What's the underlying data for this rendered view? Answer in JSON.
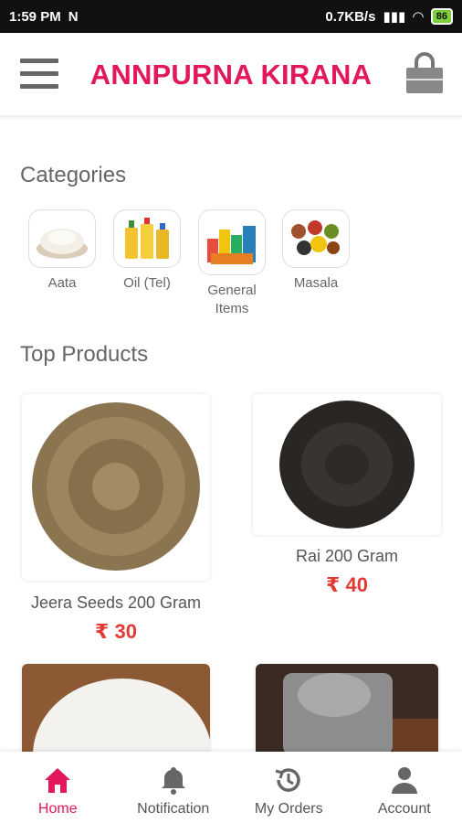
{
  "status": {
    "time": "1:59 PM",
    "speed": "0.7KB/s",
    "battery": "86"
  },
  "header": {
    "title": "ANNPURNA KIRANA"
  },
  "sections": {
    "categories": "Categories",
    "top_products": "Top Products"
  },
  "categories": [
    {
      "label": "Aata"
    },
    {
      "label": "Oil (Tel)"
    },
    {
      "label": "General Items"
    },
    {
      "label": "Masala"
    }
  ],
  "products": [
    {
      "name": "Jeera Seeds 200 Gram",
      "price": "₹ 30"
    },
    {
      "name": "Rai 200 Gram",
      "price": "₹ 40"
    }
  ],
  "nav": [
    {
      "label": "Home"
    },
    {
      "label": "Notification"
    },
    {
      "label": "My Orders"
    },
    {
      "label": "Account"
    }
  ],
  "colors": {
    "brand": "#e2185a",
    "price": "#e53935"
  }
}
